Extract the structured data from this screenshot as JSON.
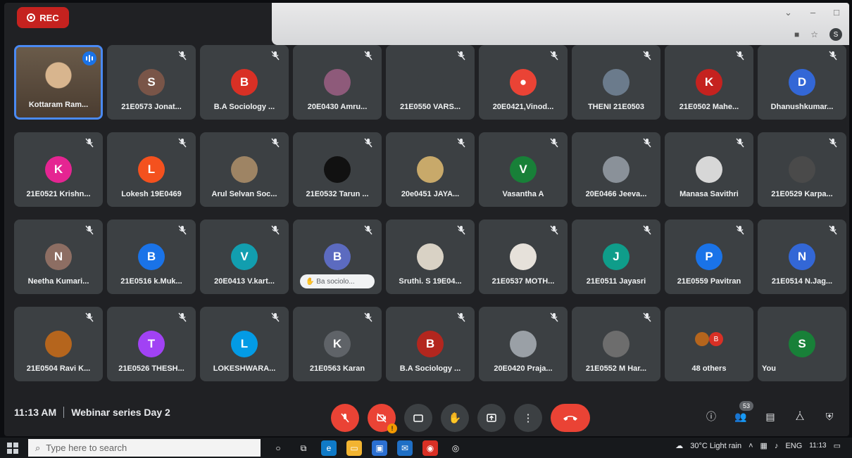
{
  "window": {
    "rec_label": "REC",
    "profile_initial": "S"
  },
  "tiles": [
    {
      "name": "Kottaram Ram...",
      "featured": true
    },
    {
      "name": "21E0573 Jonat...",
      "initial": "S",
      "color": "#795548"
    },
    {
      "name": "B.A Sociology ...",
      "initial": "B",
      "color": "#d93025"
    },
    {
      "name": "20E0430 Amru...",
      "icon": "photo",
      "color": "#8e5a7a"
    },
    {
      "name": "21E0550 VARS...",
      "icon": "photo",
      "color": "#3c4043"
    },
    {
      "name": "20E0421,Vinod...",
      "icon": "person",
      "color": "#ea4335"
    },
    {
      "name": "THENI 21E0503",
      "icon": "photo",
      "color": "#6b7b8c"
    },
    {
      "name": "21E0502 Mahe...",
      "initial": "K",
      "color": "#c5221f"
    },
    {
      "name": "Dhanushkumar...",
      "initial": "D",
      "color": "#3367d6"
    },
    {
      "name": "21E0521 Krishn...",
      "initial": "K",
      "color": "#e52592"
    },
    {
      "name": "Lokesh 19E0469",
      "initial": "L",
      "color": "#f4511e"
    },
    {
      "name": "Arul Selvan Soc...",
      "icon": "photo",
      "color": "#9e8464"
    },
    {
      "name": "21E0532 Tarun ...",
      "icon": "photo",
      "color": "#111111"
    },
    {
      "name": "20e0451 JAYA...",
      "icon": "photo",
      "color": "#c8a96a"
    },
    {
      "name": "Vasantha A",
      "initial": "V",
      "color": "#188038"
    },
    {
      "name": "20E0466 Jeeva...",
      "icon": "photo",
      "color": "#8a9199"
    },
    {
      "name": "Manasa Savithri",
      "icon": "photo",
      "color": "#d7d7d7"
    },
    {
      "name": "21E0529 Karpa...",
      "icon": "photo",
      "color": "#4a4a4a"
    },
    {
      "name": "Neetha Kumari...",
      "initial": "N",
      "color": "#8d6e63"
    },
    {
      "name": "21E0516 k.Muk...",
      "initial": "B",
      "color": "#1a73e8"
    },
    {
      "name": "20E0413 V.kart...",
      "initial": "V",
      "color": "#129eaf"
    },
    {
      "name": "",
      "initial": "B",
      "color": "#5c6bc0",
      "chip": "Ba sociolo..."
    },
    {
      "name": "Sruthi. S 19E04...",
      "icon": "photo",
      "color": "#d9d2c5"
    },
    {
      "name": "21E0537 MOTH...",
      "icon": "photo",
      "color": "#e6e1da"
    },
    {
      "name": "21E0511 Jayasri",
      "initial": "J",
      "color": "#0f9d8a"
    },
    {
      "name": "21E0559 Pavitran",
      "initial": "P",
      "color": "#1a73e8"
    },
    {
      "name": "21E0514 N.Jag...",
      "initial": "N",
      "color": "#3367d6"
    },
    {
      "name": "21E0504 Ravi K...",
      "icon": "photo",
      "color": "#b5651d"
    },
    {
      "name": "21E0526 THESH...",
      "initial": "T",
      "color": "#a142f4"
    },
    {
      "name": "LOKESHWARA...",
      "initial": "L",
      "color": "#039be5"
    },
    {
      "name": "21E0563 Karan",
      "initial": "K",
      "color": "#5f6368"
    },
    {
      "name": "B.A Sociology ...",
      "initial": "B",
      "color": "#b3261e"
    },
    {
      "name": "20E0420 Praja...",
      "icon": "photo",
      "color": "#9aa0a6"
    },
    {
      "name": "21E0552 M Har...",
      "icon": "photo",
      "color": "#6d6d6d"
    },
    {
      "name": "48 others",
      "others": true,
      "others_initial": "B"
    },
    {
      "name": "You",
      "initial": "S",
      "color": "#188038",
      "self": true
    }
  ],
  "bottom": {
    "time": "11:13 AM",
    "meeting_title": "Webinar series Day 2",
    "participants_count": "53"
  },
  "taskbar": {
    "search_placeholder": "Type here to search",
    "weather": "30°C Light rain",
    "lang": "ENG",
    "clock_time": "11:13"
  }
}
